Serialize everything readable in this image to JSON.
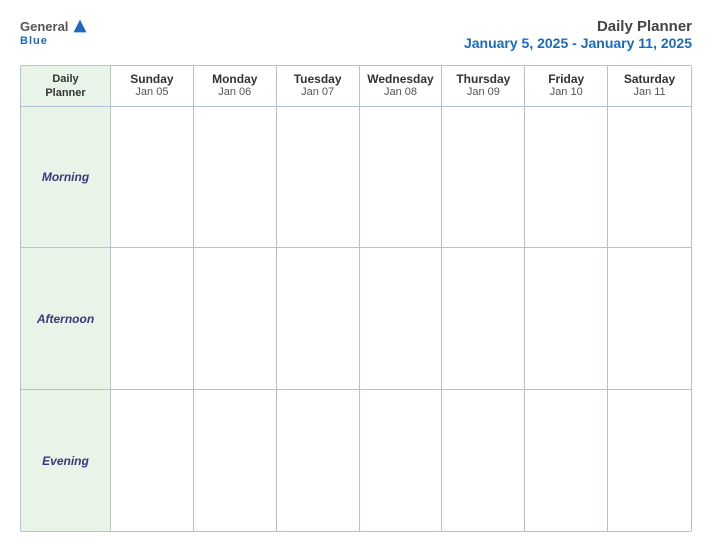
{
  "header": {
    "logo_general": "General",
    "logo_blue": "Blue",
    "logo_underline": "Blue",
    "title": "Daily Planner",
    "dates": "January 5, 2025 - January 11, 2025"
  },
  "calendar": {
    "first_col_label_line1": "Daily",
    "first_col_label_line2": "Planner",
    "columns": [
      {
        "day": "Sunday",
        "date": "Jan 05"
      },
      {
        "day": "Monday",
        "date": "Jan 06"
      },
      {
        "day": "Tuesday",
        "date": "Jan 07"
      },
      {
        "day": "Wednesday",
        "date": "Jan 08"
      },
      {
        "day": "Thursday",
        "date": "Jan 09"
      },
      {
        "day": "Friday",
        "date": "Jan 10"
      },
      {
        "day": "Saturday",
        "date": "Jan 11"
      }
    ],
    "rows": [
      {
        "label": "Morning"
      },
      {
        "label": "Afternoon"
      },
      {
        "label": "Evening"
      }
    ]
  }
}
